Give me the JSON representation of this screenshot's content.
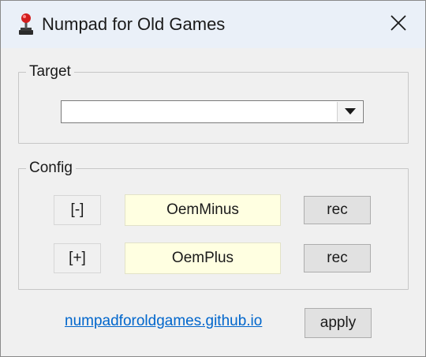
{
  "window": {
    "title": "Numpad for Old Games",
    "icon": "joystick-icon",
    "close_icon": "close-icon"
  },
  "target": {
    "group_label": "Target",
    "selected_value": "",
    "dropdown_icon": "triangle-down-icon"
  },
  "config": {
    "group_label": "Config",
    "rows": [
      {
        "key": "[-]",
        "value": "OemMinus",
        "button": "rec"
      },
      {
        "key": "[+]",
        "value": "OemPlus",
        "button": "rec"
      }
    ]
  },
  "footer": {
    "link_text": "numpadforoldgames.github.io",
    "apply_label": "apply"
  },
  "colors": {
    "link": "#0066cc",
    "value_bg": "#ffffe1",
    "titlebar_bg": "#eaf0f8",
    "icon_red": "#d21e1e"
  }
}
